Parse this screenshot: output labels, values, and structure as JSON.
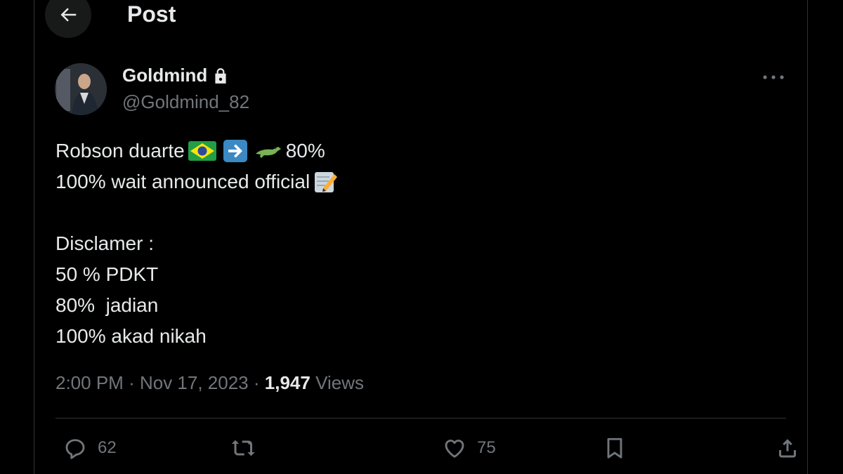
{
  "header": {
    "title": "Post",
    "back_icon": "arrow-left-icon"
  },
  "author": {
    "display_name": "Goldmind",
    "handle": "@Goldmind_82",
    "lock_icon": "lock-icon"
  },
  "post": {
    "line1_text": "Robson duarte",
    "line1_suffix": "80%",
    "line2_text": "100% wait announced official",
    "line3": "Disclamer :",
    "line4": "50 % PDKT",
    "line5": "80%  jadian",
    "line6": "100% akad nikah",
    "emojis": [
      "brazil-flag-icon",
      "right-arrow-icon",
      "crocodile-icon",
      "memo-icon"
    ]
  },
  "meta": {
    "time": "2:00 PM",
    "date": "Nov 17, 2023",
    "separator": "·",
    "views_count": "1,947",
    "views_label": "Views"
  },
  "actions": {
    "reply_count": "62",
    "like_count": "75"
  },
  "colors": {
    "background": "#000000",
    "text": "#e7e9ea",
    "muted": "#71767b",
    "border": "#2f3336"
  }
}
